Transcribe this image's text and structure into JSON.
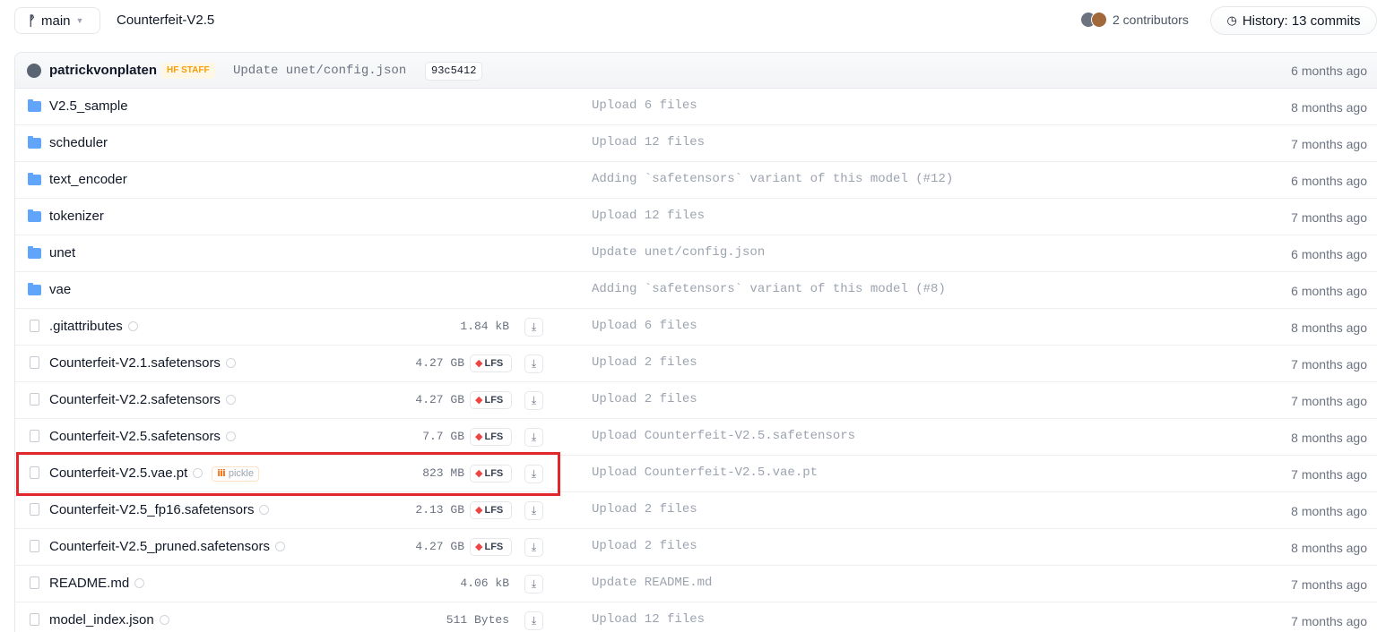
{
  "topbar": {
    "branch": "main",
    "repo_name": "Counterfeit-V2.5",
    "contributors": "2 contributors",
    "history": "History: 13 commits"
  },
  "commit": {
    "author": "patrickvonplaten",
    "badge": "HF STAFF",
    "message": "Update unet/config.json",
    "hash": "93c5412",
    "time": "6 months ago"
  },
  "files": [
    {
      "type": "folder",
      "name": "V2.5_sample",
      "size": "",
      "lfs": false,
      "safe": false,
      "pickle": false,
      "download": false,
      "message": "Upload 6 files",
      "time": "8 months ago"
    },
    {
      "type": "folder",
      "name": "scheduler",
      "size": "",
      "lfs": false,
      "safe": false,
      "pickle": false,
      "download": false,
      "message": "Upload 12 files",
      "time": "7 months ago"
    },
    {
      "type": "folder",
      "name": "text_encoder",
      "size": "",
      "lfs": false,
      "safe": false,
      "pickle": false,
      "download": false,
      "message": "Adding `safetensors` variant of this model (#12)",
      "time": "6 months ago"
    },
    {
      "type": "folder",
      "name": "tokenizer",
      "size": "",
      "lfs": false,
      "safe": false,
      "pickle": false,
      "download": false,
      "message": "Upload 12 files",
      "time": "7 months ago"
    },
    {
      "type": "folder",
      "name": "unet",
      "size": "",
      "lfs": false,
      "safe": false,
      "pickle": false,
      "download": false,
      "message": "Update unet/config.json",
      "time": "6 months ago"
    },
    {
      "type": "folder",
      "name": "vae",
      "size": "",
      "lfs": false,
      "safe": false,
      "pickle": false,
      "download": false,
      "message": "Adding `safetensors` variant of this model (#8)",
      "time": "6 months ago"
    },
    {
      "type": "file",
      "name": ".gitattributes",
      "size": "1.84 kB",
      "lfs": false,
      "safe": true,
      "pickle": false,
      "download": true,
      "message": "Upload 6 files",
      "time": "8 months ago"
    },
    {
      "type": "file",
      "name": "Counterfeit-V2.1.safetensors",
      "size": "4.27 GB",
      "lfs": true,
      "safe": true,
      "pickle": false,
      "download": true,
      "message": "Upload 2 files",
      "time": "7 months ago"
    },
    {
      "type": "file",
      "name": "Counterfeit-V2.2.safetensors",
      "size": "4.27 GB",
      "lfs": true,
      "safe": true,
      "pickle": false,
      "download": true,
      "message": "Upload 2 files",
      "time": "7 months ago"
    },
    {
      "type": "file",
      "name": "Counterfeit-V2.5.safetensors",
      "size": "7.7 GB",
      "lfs": true,
      "safe": true,
      "pickle": false,
      "download": true,
      "message": "Upload Counterfeit-V2.5.safetensors",
      "time": "8 months ago"
    },
    {
      "type": "file",
      "name": "Counterfeit-V2.5.vae.pt",
      "size": "823 MB",
      "lfs": true,
      "safe": true,
      "pickle": true,
      "download": true,
      "message": "Upload Counterfeit-V2.5.vae.pt",
      "time": "7 months ago"
    },
    {
      "type": "file",
      "name": "Counterfeit-V2.5_fp16.safetensors",
      "size": "2.13 GB",
      "lfs": true,
      "safe": true,
      "pickle": false,
      "download": true,
      "message": "Upload 2 files",
      "time": "8 months ago"
    },
    {
      "type": "file",
      "name": "Counterfeit-V2.5_pruned.safetensors",
      "size": "4.27 GB",
      "lfs": true,
      "safe": true,
      "pickle": false,
      "download": true,
      "message": "Upload 2 files",
      "time": "8 months ago"
    },
    {
      "type": "file",
      "name": "README.md",
      "size": "4.06 kB",
      "lfs": false,
      "safe": true,
      "pickle": false,
      "download": true,
      "message": "Update README.md",
      "time": "7 months ago"
    },
    {
      "type": "file",
      "name": "model_index.json",
      "size": "511 Bytes",
      "lfs": false,
      "safe": true,
      "pickle": false,
      "download": true,
      "message": "Upload 12 files",
      "time": "7 months ago"
    }
  ],
  "labels": {
    "lfs": "LFS",
    "pickle": "pickle"
  },
  "icons": {
    "branch": "git-branch-icon",
    "caret": "chevron-down-icon",
    "clock": "clock-icon",
    "folder": "folder-icon",
    "file": "file-icon",
    "download": "download-icon",
    "lfs": "lfs-icon",
    "pickle": "pickle-icon"
  },
  "colors": {
    "folder": "#60a5fa",
    "highlight": "#e3262c",
    "lfs": "#ef4444",
    "pickle": "#f97316",
    "staff": "#f59e0b"
  }
}
